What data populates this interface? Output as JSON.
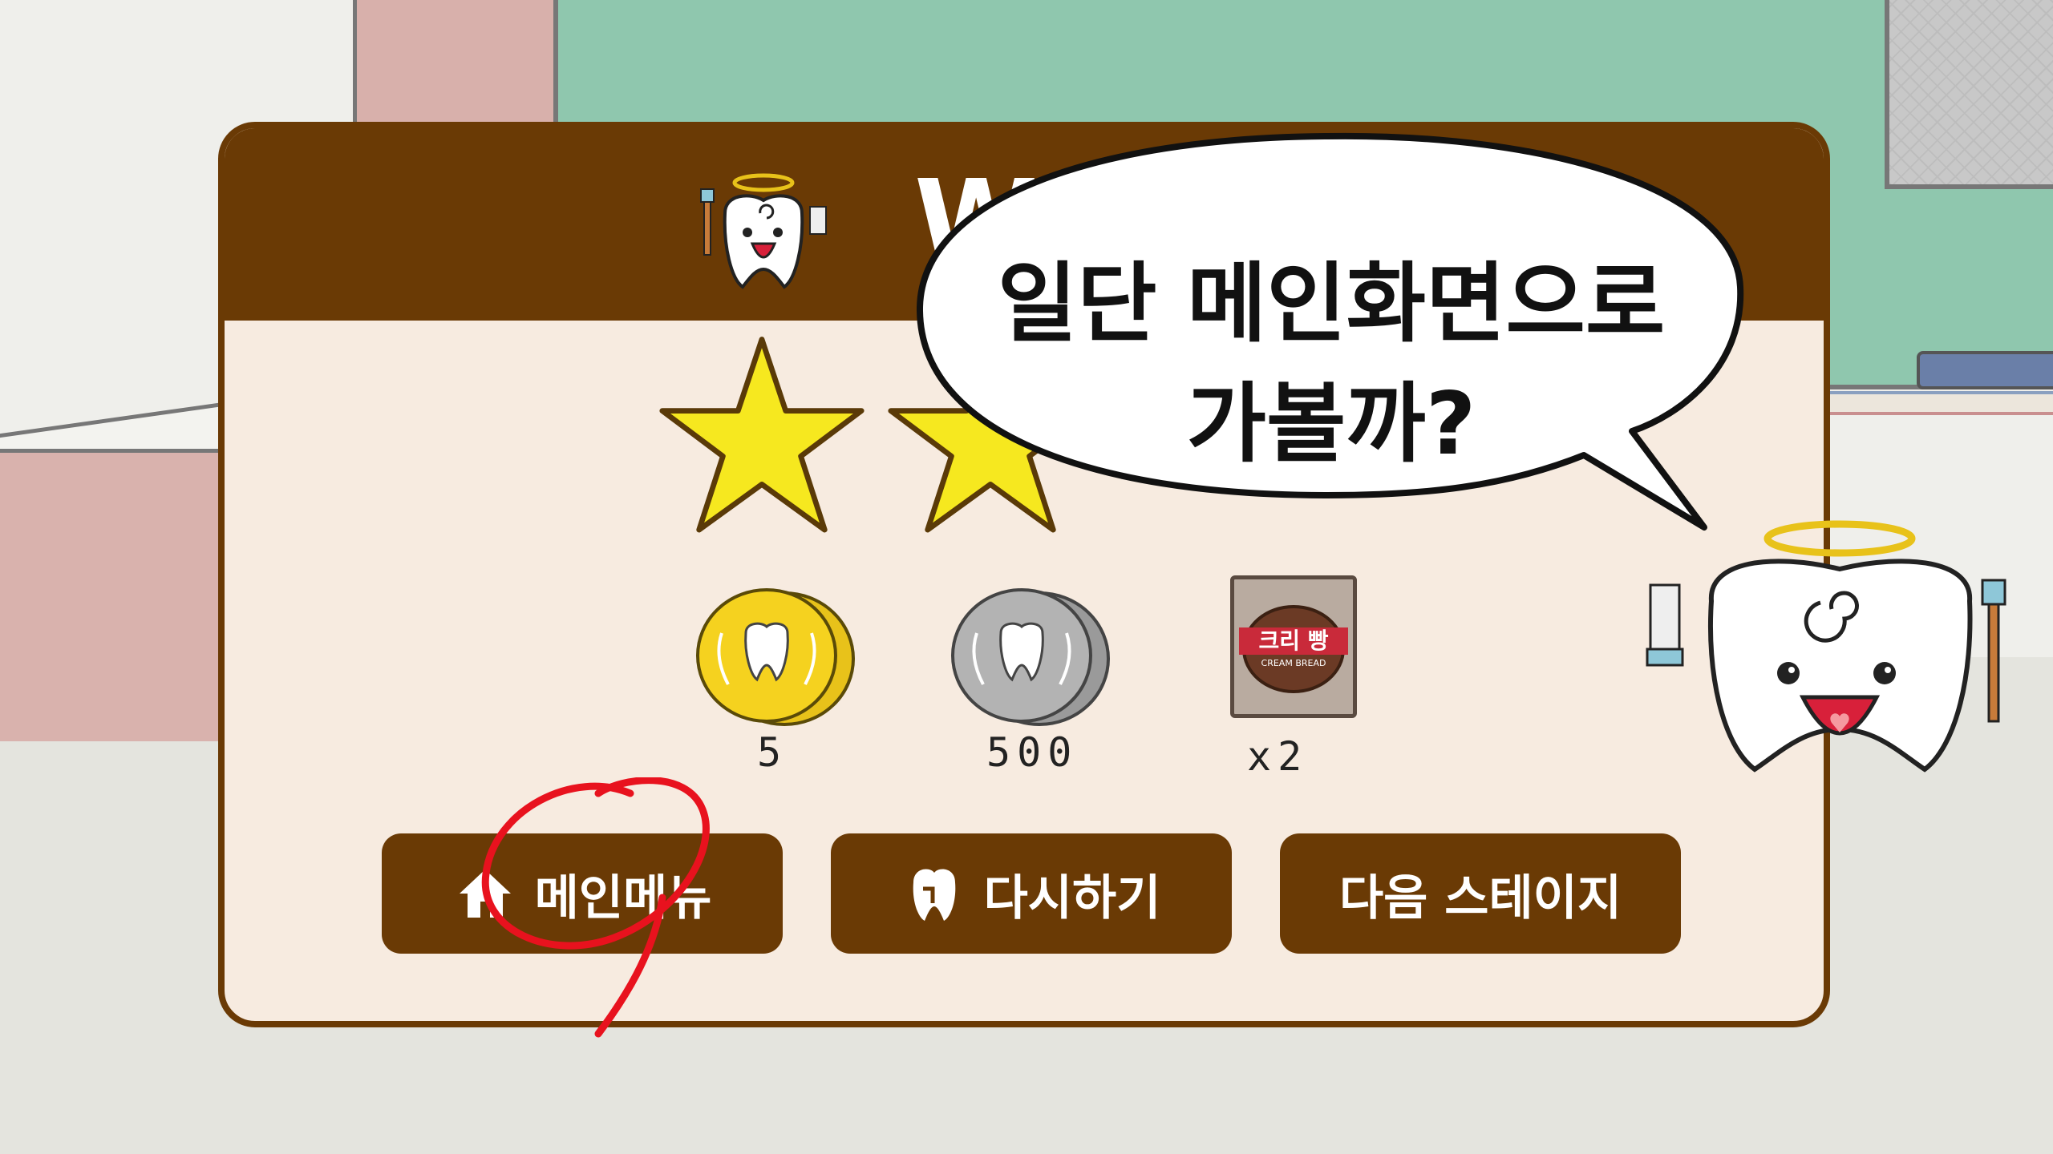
{
  "panel": {
    "title": "Wi"
  },
  "stars": {
    "earned": 2,
    "total": 3
  },
  "rewards": [
    {
      "icon": "gold-coin-icon",
      "label": "5"
    },
    {
      "icon": "silver-coin-icon",
      "label": "500"
    },
    {
      "icon": "cream-bread-icon",
      "label": "x2",
      "brand": "크리 빵",
      "sub": "CREAM BREAD"
    }
  ],
  "buttons": {
    "main_menu": "메인메뉴",
    "retry": "다시하기",
    "next_stage": "다음 스테이지"
  },
  "speech": {
    "line1": "일단 메인화면으로",
    "line2": "가볼까?"
  },
  "colors": {
    "panel_brown": "#6a3a05",
    "panel_cream": "#f7ebe0",
    "star_yellow": "#f6e81f",
    "annotation_red": "#e8121e"
  }
}
